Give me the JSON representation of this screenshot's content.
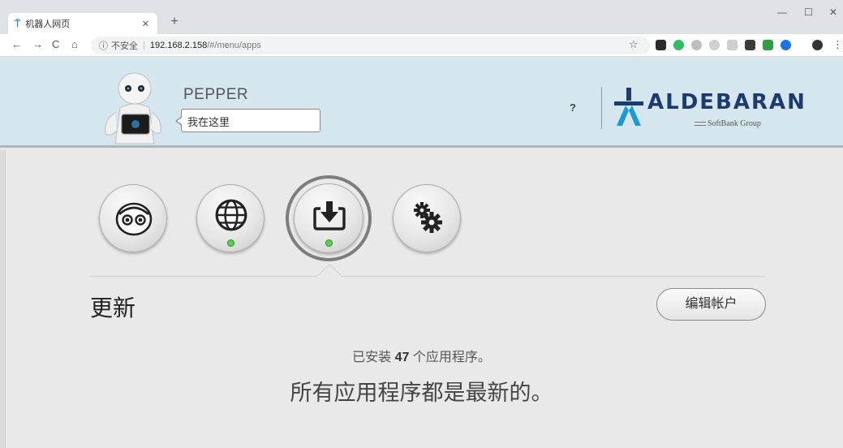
{
  "browser": {
    "tab_title": "机器人网页",
    "tab_favicon": "aldebaran-logo",
    "url_security": "不安全",
    "url_host": "192.168.2.158",
    "url_path": "/#/menu/apps"
  },
  "header": {
    "robot_name": "PEPPER",
    "speech_bubble": "我在这里",
    "help_label": "?",
    "brand_name": "ALDEBARAN",
    "brand_sub": "SoftBank Group"
  },
  "menu": {
    "items": [
      {
        "name": "robot-face",
        "icon": "robot-face-icon",
        "status": "none"
      },
      {
        "name": "network",
        "icon": "globe-icon",
        "status": "green"
      },
      {
        "name": "updates",
        "icon": "download-icon",
        "status": "green",
        "selected": true
      },
      {
        "name": "settings",
        "icon": "gears-icon",
        "status": "none"
      }
    ]
  },
  "main": {
    "section_title": "更新",
    "edit_account_label": "编辑帐户",
    "installed_prefix": "已安装",
    "installed_count": "47",
    "installed_suffix": "个应用程序。",
    "status_message": "所有应用程序都是最新的。"
  },
  "colors": {
    "header_bg": "#d6e6ef",
    "brand_blue": "#1c3b6e",
    "status_green": "#5bd34a",
    "page_bg": "#e9e9e9"
  }
}
